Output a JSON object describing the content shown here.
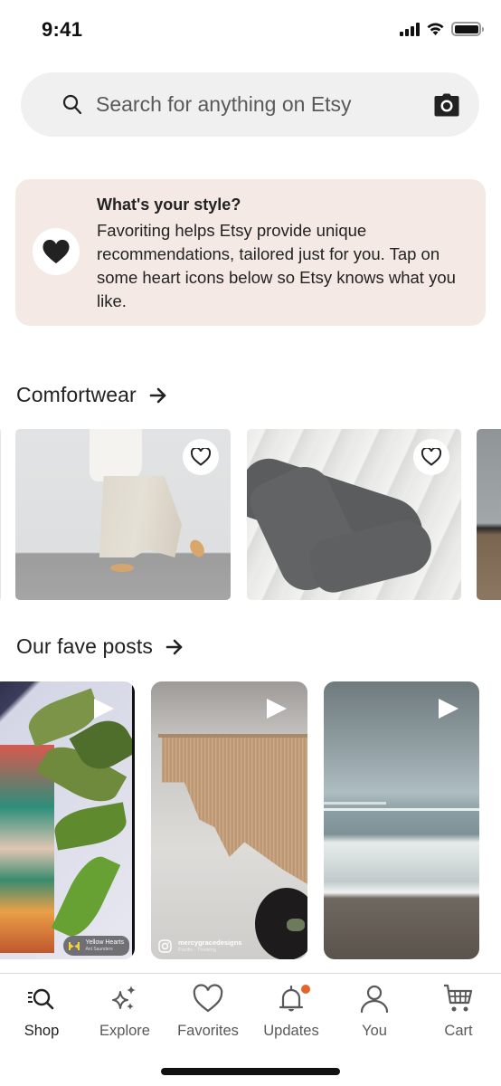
{
  "status_bar": {
    "time": "9:41"
  },
  "search": {
    "placeholder": "Search for anything on Etsy",
    "value": "",
    "search_icon": "search-icon",
    "camera_icon": "camera-icon"
  },
  "style_card": {
    "icon": "heart-filled-icon",
    "title": "What's your style?",
    "body": "Favoriting helps Etsy provide unique recommendations, tailored just for you. Tap on some heart icons below so Etsy knows what you like."
  },
  "sections": [
    {
      "title": "Comfortwear",
      "arrow_icon": "arrow-right-icon",
      "items": [
        {
          "description": "Wide-leg linen pants",
          "favorite_icon": "heart-outline-icon"
        },
        {
          "description": "Cable knit grey socks",
          "favorite_icon": "heart-outline-icon"
        },
        {
          "description": "Partially visible item"
        }
      ]
    },
    {
      "title": "Our fave posts",
      "arrow_icon": "arrow-right-icon",
      "posts": [
        {
          "description": "Plant and colorful poster",
          "play_icon": "play-icon",
          "badge_title": "Yellow Hearts",
          "badge_subtitle": "Ant Saunders"
        },
        {
          "description": "Macrame wall hanging",
          "play_icon": "play-icon",
          "creator": "mercygracedesigns",
          "audio": "Pacific · Thinking"
        },
        {
          "description": "Beach waves",
          "play_icon": "play-icon"
        }
      ]
    }
  ],
  "bottom_nav": {
    "items": [
      {
        "label": "Shop",
        "icon": "shop-search-icon",
        "active": true
      },
      {
        "label": "Explore",
        "icon": "sparkle-icon",
        "active": false
      },
      {
        "label": "Favorites",
        "icon": "heart-outline-icon",
        "active": false
      },
      {
        "label": "Updates",
        "icon": "bell-icon",
        "active": false,
        "has_notification": true
      },
      {
        "label": "You",
        "icon": "person-icon",
        "active": false
      },
      {
        "label": "Cart",
        "icon": "cart-icon",
        "active": false
      }
    ]
  },
  "colors": {
    "style_card_bg": "#f5e9e5",
    "search_bg": "#f0f0f0",
    "notification_dot": "#e4652b",
    "text_primary": "#222222",
    "text_secondary": "#595959"
  }
}
